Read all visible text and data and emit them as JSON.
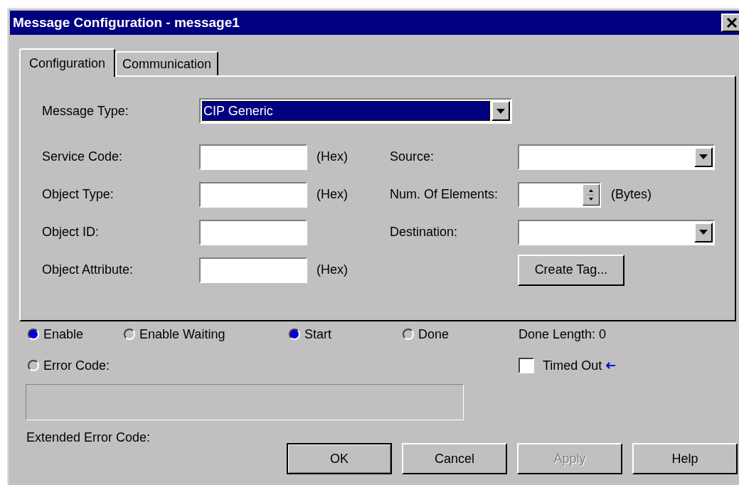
{
  "window": {
    "title": "Message Configuration - message1"
  },
  "tabs": [
    {
      "label": "Configuration",
      "selected": true
    },
    {
      "label": "Communication",
      "selected": false
    }
  ],
  "message_type": {
    "label": "Message Type:",
    "value": "CIP Generic"
  },
  "left_fields": [
    {
      "label": "Service Code:",
      "unit": "(Hex)"
    },
    {
      "label": "Object Type:",
      "unit": "(Hex)"
    },
    {
      "label": "Object ID:"
    },
    {
      "label": "Object Attribute:",
      "unit": "(Hex)"
    }
  ],
  "right_fields": [
    {
      "kind": "dropdown",
      "label": "Source:"
    },
    {
      "kind": "spinner",
      "label": "Num. Of Elements:",
      "unit": "(Bytes)"
    },
    {
      "kind": "dropdown",
      "label": "Destination:"
    },
    {
      "kind": "button",
      "label": "Create Tag..."
    }
  ],
  "status": [
    {
      "label": "Enable",
      "on": true
    },
    {
      "label": "Enable Waiting",
      "on": false
    },
    {
      "label": "Start",
      "on": true
    },
    {
      "label": "Done",
      "on": false
    }
  ],
  "done_length": "Done Length:  0",
  "error_code": {
    "label": "Error Code:",
    "on": false
  },
  "timed_out": {
    "label": "Timed Out",
    "checked": false
  },
  "extended_error_label": "Extended Error Code:",
  "buttons": [
    {
      "label": "OK",
      "default": true,
      "disabled": false
    },
    {
      "label": "Cancel",
      "default": false,
      "disabled": false
    },
    {
      "label": "Apply",
      "default": false,
      "disabled": true
    },
    {
      "label": "Help",
      "default": false,
      "disabled": false
    }
  ]
}
